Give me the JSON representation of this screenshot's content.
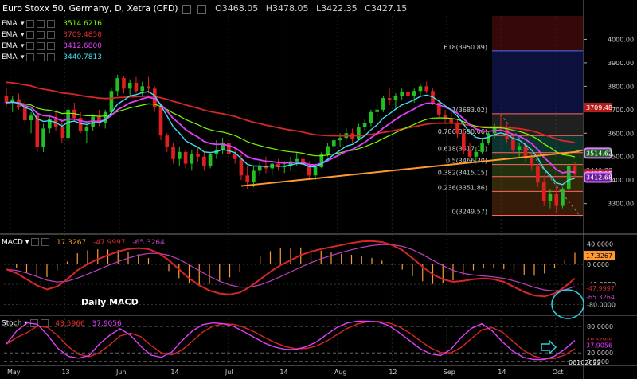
{
  "header": {
    "symbol": "Euro Stoxx 50, Germany, D, Xetra (CFD)",
    "open": "O3468.05",
    "high": "H3478.05",
    "low": "L3422.35",
    "close": "C3427.15"
  },
  "ema_legend": [
    {
      "name": "EMA",
      "value": "3514.6216",
      "color": "#7CFC00"
    },
    {
      "name": "EMA",
      "value": "3709.4858",
      "color": "#d62728"
    },
    {
      "name": "EMA",
      "value": "3412.6800",
      "color": "#e040fb"
    },
    {
      "name": "EMA",
      "value": "3440.7813",
      "color": "#40e0f0"
    }
  ],
  "macd_legend": {
    "name": "MACD",
    "v1": "17.3267",
    "v2": "-47.9997",
    "v3": "-65.3264"
  },
  "stoch_legend": {
    "name": "Stoch",
    "v1": "48.5966",
    "v2": "37.9056"
  },
  "annotations": {
    "daily_macd": "Daily MACD",
    "date_stamp": "06102022"
  },
  "colors": {
    "up": "#22c022",
    "down": "#e02020",
    "ema_short": "#40e0f0",
    "ema_mid": "#e040fb",
    "ema_long": "#7CFC00",
    "ema_200": "#d62728",
    "trendline": "#ff9933",
    "fib": "#ff6666"
  },
  "chart_data": [
    {
      "type": "candlestick",
      "title": "Euro Stoxx 50, Germany, D, Xetra (CFD)",
      "ylim": [
        3180,
        4100
      ],
      "yticks": [
        3300,
        3400,
        3500,
        3600,
        3700,
        3800,
        3900,
        4000
      ],
      "x_tick_labels": [
        "May",
        "13",
        "Jun",
        "14",
        "Jul",
        "14",
        "Aug",
        "12",
        "Sep",
        "14",
        "Oct"
      ],
      "candles_ohlc": [
        [
          3760,
          3792,
          3715,
          3730
        ],
        [
          3730,
          3760,
          3690,
          3745
        ],
        [
          3745,
          3770,
          3700,
          3710
        ],
        [
          3710,
          3740,
          3640,
          3655
        ],
        [
          3655,
          3690,
          3600,
          3675
        ],
        [
          3675,
          3700,
          3520,
          3540
        ],
        [
          3540,
          3640,
          3520,
          3620
        ],
        [
          3620,
          3680,
          3600,
          3660
        ],
        [
          3660,
          3700,
          3610,
          3625
        ],
        [
          3625,
          3660,
          3560,
          3580
        ],
        [
          3580,
          3720,
          3570,
          3700
        ],
        [
          3700,
          3730,
          3650,
          3665
        ],
        [
          3665,
          3690,
          3600,
          3610
        ],
        [
          3610,
          3640,
          3560,
          3625
        ],
        [
          3625,
          3680,
          3610,
          3670
        ],
        [
          3670,
          3700,
          3630,
          3645
        ],
        [
          3645,
          3700,
          3620,
          3690
        ],
        [
          3690,
          3790,
          3680,
          3780
        ],
        [
          3780,
          3850,
          3760,
          3835
        ],
        [
          3835,
          3845,
          3770,
          3790
        ],
        [
          3790,
          3830,
          3760,
          3815
        ],
        [
          3815,
          3840,
          3770,
          3780
        ],
        [
          3780,
          3820,
          3760,
          3800
        ],
        [
          3800,
          3840,
          3770,
          3790
        ],
        [
          3790,
          3800,
          3690,
          3710
        ],
        [
          3710,
          3720,
          3570,
          3590
        ],
        [
          3590,
          3600,
          3520,
          3540
        ],
        [
          3540,
          3560,
          3470,
          3490
        ],
        [
          3490,
          3540,
          3460,
          3520
        ],
        [
          3520,
          3530,
          3450,
          3470
        ],
        [
          3470,
          3530,
          3440,
          3510
        ],
        [
          3510,
          3540,
          3480,
          3500
        ],
        [
          3500,
          3520,
          3440,
          3460
        ],
        [
          3460,
          3520,
          3450,
          3510
        ],
        [
          3510,
          3570,
          3490,
          3530
        ],
        [
          3530,
          3580,
          3510,
          3560
        ],
        [
          3560,
          3570,
          3490,
          3510
        ],
        [
          3510,
          3540,
          3470,
          3490
        ],
        [
          3490,
          3510,
          3400,
          3420
        ],
        [
          3420,
          3460,
          3360,
          3390
        ],
        [
          3390,
          3460,
          3370,
          3440
        ],
        [
          3440,
          3480,
          3420,
          3460
        ],
        [
          3460,
          3500,
          3430,
          3450
        ],
        [
          3450,
          3480,
          3420,
          3470
        ],
        [
          3470,
          3490,
          3440,
          3455
        ],
        [
          3455,
          3480,
          3430,
          3460
        ],
        [
          3460,
          3500,
          3440,
          3480
        ],
        [
          3480,
          3520,
          3460,
          3490
        ],
        [
          3490,
          3510,
          3450,
          3465
        ],
        [
          3465,
          3480,
          3400,
          3420
        ],
        [
          3420,
          3470,
          3400,
          3455
        ],
        [
          3455,
          3520,
          3450,
          3510
        ],
        [
          3510,
          3560,
          3500,
          3545
        ],
        [
          3545,
          3580,
          3530,
          3570
        ],
        [
          3570,
          3600,
          3540,
          3580
        ],
        [
          3580,
          3620,
          3570,
          3600
        ],
        [
          3600,
          3620,
          3560,
          3575
        ],
        [
          3575,
          3640,
          3570,
          3625
        ],
        [
          3625,
          3660,
          3610,
          3645
        ],
        [
          3645,
          3700,
          3630,
          3690
        ],
        [
          3690,
          3720,
          3660,
          3700
        ],
        [
          3700,
          3760,
          3690,
          3750
        ],
        [
          3750,
          3790,
          3720,
          3740
        ],
        [
          3740,
          3770,
          3700,
          3760
        ],
        [
          3760,
          3790,
          3740,
          3775
        ],
        [
          3775,
          3800,
          3740,
          3760
        ],
        [
          3760,
          3790,
          3730,
          3780
        ],
        [
          3780,
          3810,
          3760,
          3800
        ],
        [
          3800,
          3820,
          3770,
          3780
        ],
        [
          3780,
          3790,
          3720,
          3730
        ],
        [
          3730,
          3740,
          3670,
          3680
        ],
        [
          3680,
          3700,
          3640,
          3660
        ],
        [
          3660,
          3690,
          3620,
          3640
        ],
        [
          3640,
          3660,
          3580,
          3600
        ],
        [
          3600,
          3620,
          3510,
          3530
        ],
        [
          3530,
          3560,
          3490,
          3500
        ],
        [
          3500,
          3540,
          3470,
          3520
        ],
        [
          3520,
          3580,
          3510,
          3560
        ],
        [
          3560,
          3610,
          3550,
          3600
        ],
        [
          3600,
          3640,
          3580,
          3630
        ],
        [
          3630,
          3683,
          3610,
          3620
        ],
        [
          3620,
          3640,
          3560,
          3575
        ],
        [
          3575,
          3590,
          3510,
          3530
        ],
        [
          3530,
          3560,
          3500,
          3545
        ],
        [
          3545,
          3560,
          3480,
          3495
        ],
        [
          3495,
          3520,
          3440,
          3460
        ],
        [
          3460,
          3470,
          3370,
          3390
        ],
        [
          3390,
          3420,
          3290,
          3310
        ],
        [
          3310,
          3360,
          3280,
          3340
        ],
        [
          3340,
          3380,
          3260,
          3290
        ],
        [
          3290,
          3370,
          3280,
          3360
        ],
        [
          3360,
          3470,
          3350,
          3460
        ],
        [
          3460,
          3478,
          3410,
          3427
        ]
      ],
      "ema_series": [
        {
          "name": "EMA",
          "value_label": "3514.6216",
          "color": "#7CFC00"
        },
        {
          "name": "EMA",
          "value_label": "3709.4858",
          "color": "#d62728"
        },
        {
          "name": "EMA",
          "value_label": "3412.6800",
          "color": "#e040fb"
        },
        {
          "name": "EMA",
          "value_label": "3440.7813",
          "color": "#40e0f0"
        }
      ],
      "fib_levels": [
        {
          "label": "1.618(3950.89)",
          "value": 3950.89
        },
        {
          "label": "1(3683.02)",
          "value": 3683.02
        },
        {
          "label": "0.786(3590.06)",
          "value": 3590.06
        },
        {
          "label": "0.618(3517.14)",
          "value": 3517.14
        },
        {
          "label": "0.5(3466.30)",
          "value": 3466.3
        },
        {
          "label": "0.382(3415.15)",
          "value": 3415.15
        },
        {
          "label": "0.236(3351.86)",
          "value": 3351.86
        },
        {
          "label": "0(3249.57)",
          "value": 3249.57
        }
      ],
      "trendline": {
        "from": [
          38,
          3375
        ],
        "to": [
          92,
          3520
        ]
      },
      "price_tags": [
        {
          "text": "3709.48",
          "value": 3709.48,
          "bg": "#b71c1c",
          "fg": "#ffffff"
        },
        {
          "text": "3514.62",
          "value": 3514.62,
          "bg": "#1b5e20",
          "fg": "#ffffff",
          "ring": true
        },
        {
          "text": "3440.78",
          "value": 3440.78,
          "bg": "#000000",
          "fg": "#40e0f0"
        },
        {
          "text": "3427.15",
          "value": 3427.15,
          "bg": "#b71c1c",
          "fg": "#ffffff"
        },
        {
          "text": "3412.68",
          "value": 3412.68,
          "bg": "#6a1b9a",
          "fg": "#ffffff",
          "ring": true
        }
      ]
    },
    {
      "type": "line",
      "title": "MACD",
      "ylim": [
        -95,
        55
      ],
      "yticks": [
        40,
        0,
        -40,
        -80
      ],
      "ytick_labels": [
        "40.0000",
        "0.0000",
        "-40.0000",
        "-80.0000"
      ],
      "series": [
        {
          "name": "MACD",
          "value_label": "-47.9997",
          "color": "#d62728"
        },
        {
          "name": "Signal",
          "value_label": "-65.3264",
          "color": "#c040c0"
        },
        {
          "name": "Histogram",
          "value_label": "17.3267",
          "color": "#f0a020"
        }
      ],
      "macd_values": [
        -10,
        -18,
        -30,
        -42,
        -50,
        -44,
        -30,
        -12,
        0,
        10,
        18,
        25,
        30,
        32,
        30,
        22,
        8,
        -10,
        -28,
        -42,
        -52,
        -58,
        -60,
        -56,
        -45,
        -30,
        -15,
        -2,
        8,
        18,
        25,
        30,
        34,
        38,
        42,
        45,
        46,
        44,
        38,
        28,
        12,
        -5,
        -20,
        -30,
        -35,
        -33,
        -30,
        -28,
        -30,
        -35,
        -45,
        -55,
        -62,
        -64,
        -58,
        -45,
        -28
      ]
    },
    {
      "type": "line",
      "title": "Stoch",
      "ylim": [
        -5,
        100
      ],
      "yticks": [
        80,
        20,
        0
      ],
      "ytick_labels": [
        "80.0000",
        "20.0000",
        "0.0000"
      ],
      "series": [
        {
          "name": "%K",
          "value_label": "48.5966",
          "color": "#e040fb"
        },
        {
          "name": "%D",
          "value_label": "37.9056",
          "color": "#d62728"
        }
      ],
      "k_values": [
        40,
        70,
        88,
        85,
        60,
        30,
        12,
        8,
        14,
        40,
        60,
        75,
        60,
        35,
        15,
        10,
        22,
        48,
        70,
        84,
        88,
        86,
        80,
        68,
        55,
        42,
        33,
        28,
        28,
        34,
        45,
        62,
        78,
        88,
        92,
        92,
        90,
        82,
        66,
        48,
        30,
        18,
        14,
        28,
        55,
        76,
        86,
        70,
        45,
        24,
        10,
        5,
        5,
        12,
        28,
        48
      ]
    }
  ]
}
